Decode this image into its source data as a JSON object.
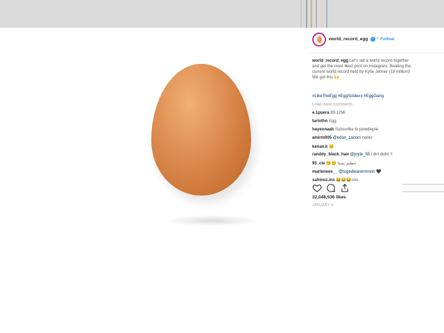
{
  "post": {
    "username": "world_record_egg",
    "verified_symbol": "✓",
    "dot": "•",
    "follow_label": "Follow",
    "caption_user": "world_record_egg",
    "caption_text": "Let's set a world record together and get the most liked post on Instagram. Beating the current world record held by Kylie Jenner (18 million)! We got this 🙌",
    "hashtags": "#LikeTheEgg #EggSoldiers #EggGang",
    "load_more": "Load more comments",
    "comments": [
      {
        "user": "e.1puera",
        "text": "89.12Mi",
        "mention": ""
      },
      {
        "user": "tarinthn",
        "text": "Egg",
        "mention": ""
      },
      {
        "user": "hayeonaah",
        "text": "Subscribe to pewdiepie",
        "mention": ""
      },
      {
        "user": "amirm005",
        "text": "",
        "mention": "@edan_zaconi",
        "after": " noder"
      },
      {
        "user": "kenan.k",
        "text": "😊",
        "mention": ""
      },
      {
        "user": "randdy_black_hair",
        "text": "",
        "mention": "@joyle_55",
        "after": " i dnt didnt !!"
      },
      {
        "user": "95_cle",
        "text": "😊😊 حظنم يسنا",
        "mention": ""
      },
      {
        "user": "marleneee__",
        "text": "",
        "mention": "@togedwarenmnnn",
        "after": " 🖤"
      },
      {
        "user": "sahinuz.ins",
        "text": "😂😂😂soo",
        "mention": ""
      }
    ],
    "likes": "32,048,536 likes",
    "date": "JANUARY 4"
  },
  "colors": {
    "topbar": "#dadada",
    "link": "#3897f0",
    "egg": "#d98a4d"
  },
  "icons": [
    "heart-icon",
    "comment-icon",
    "share-icon"
  ]
}
